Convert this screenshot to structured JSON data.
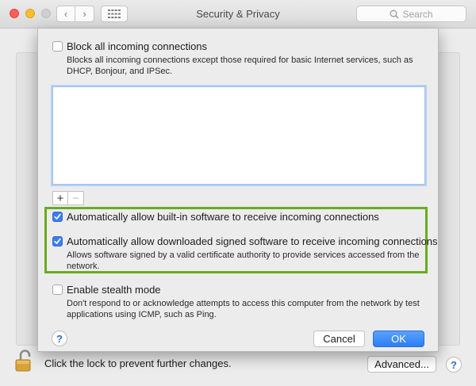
{
  "window": {
    "title": "Security & Privacy",
    "search_placeholder": "Search"
  },
  "nav": {
    "back_glyph": "‹",
    "forward_glyph": "›"
  },
  "sheet": {
    "block_all": {
      "label": "Block all incoming connections",
      "checked": false,
      "description_line1": "Blocks all incoming connections except those required for basic Internet services,  such as",
      "description_line2": "DHCP, Bonjour, and IPSec."
    },
    "app_list": [],
    "plus_glyph": "+",
    "minus_glyph": "−",
    "allow_builtin": {
      "label": "Automatically allow built-in software to receive incoming connections",
      "checked": true
    },
    "allow_signed": {
      "label": "Automatically allow downloaded signed software to receive incoming connections",
      "checked": true,
      "description_line1": "Allows software signed by a valid certificate authority to provide services accessed from the",
      "description_line2": "network."
    },
    "stealth": {
      "label": "Enable stealth mode",
      "checked": false,
      "description_line1": "Don't respond to or acknowledge attempts to access this computer from the network by test",
      "description_line2": "applications using ICMP, such as Ping."
    },
    "help_glyph": "?",
    "cancel_label": "Cancel",
    "ok_label": "OK"
  },
  "footer": {
    "lock_text": "Click the lock to prevent further changes.",
    "advanced_label": "Advanced...",
    "help_glyph": "?"
  },
  "colors": {
    "highlight": "#6aac1e",
    "accent": "#3b7ef0",
    "lock_body": "#d9a23a"
  }
}
